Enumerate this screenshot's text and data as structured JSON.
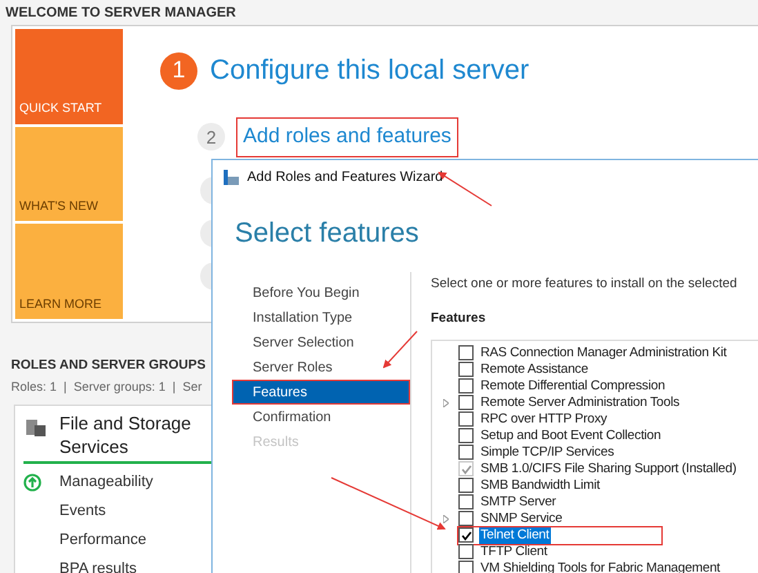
{
  "header": {
    "title": "WELCOME TO SERVER MANAGER"
  },
  "tiles": [
    {
      "label": "QUICK START",
      "color": "#f26522",
      "selected": true
    },
    {
      "label": "WHAT'S NEW",
      "color": "#fbb040",
      "selected": false
    },
    {
      "label": "LEARN MORE",
      "color": "#fbb040",
      "selected": false
    }
  ],
  "steps": [
    {
      "number": "1",
      "label": "Configure this local server",
      "kind": "primary",
      "annotated": false
    },
    {
      "number": "2",
      "label": "Add roles and features",
      "kind": "secondary",
      "annotated": true
    }
  ],
  "roles": {
    "title": "ROLES AND SERVER GROUPS",
    "summary": "Roles: 1  |  Server groups: 1  |  Ser",
    "card": {
      "title": "File and Storage Services",
      "rows": [
        {
          "label": "Manageability",
          "kind": "status"
        },
        {
          "label": "Events",
          "kind": "plain"
        },
        {
          "label": "Performance",
          "kind": "plain"
        },
        {
          "label": "BPA results",
          "kind": "plain"
        }
      ]
    }
  },
  "wizard": {
    "title": "Add Roles and Features Wizard",
    "heading": "Select features",
    "nav": [
      {
        "label": "Before You Begin",
        "selected": false,
        "disabled": false,
        "annotated": false
      },
      {
        "label": "Installation Type",
        "selected": false,
        "disabled": false,
        "annotated": false
      },
      {
        "label": "Server Selection",
        "selected": false,
        "disabled": false,
        "annotated": false
      },
      {
        "label": "Server Roles",
        "selected": false,
        "disabled": false,
        "annotated": false
      },
      {
        "label": "Features",
        "selected": true,
        "disabled": false,
        "annotated": true
      },
      {
        "label": "Confirmation",
        "selected": false,
        "disabled": false,
        "annotated": false
      },
      {
        "label": "Results",
        "selected": false,
        "disabled": true,
        "annotated": false
      }
    ],
    "description": "Select one or more features to install on the selected",
    "features_label": "Features",
    "features": [
      {
        "label": "RAS Connection Manager Administration Kit",
        "checked": false,
        "disabled": false,
        "expandable": false,
        "selected": false,
        "annotated": false
      },
      {
        "label": "Remote Assistance",
        "checked": false,
        "disabled": false,
        "expandable": false,
        "selected": false,
        "annotated": false
      },
      {
        "label": "Remote Differential Compression",
        "checked": false,
        "disabled": false,
        "expandable": false,
        "selected": false,
        "annotated": false
      },
      {
        "label": "Remote Server Administration Tools",
        "checked": false,
        "disabled": false,
        "expandable": true,
        "selected": false,
        "annotated": false
      },
      {
        "label": "RPC over HTTP Proxy",
        "checked": false,
        "disabled": false,
        "expandable": false,
        "selected": false,
        "annotated": false
      },
      {
        "label": "Setup and Boot Event Collection",
        "checked": false,
        "disabled": false,
        "expandable": false,
        "selected": false,
        "annotated": false
      },
      {
        "label": "Simple TCP/IP Services",
        "checked": false,
        "disabled": false,
        "expandable": false,
        "selected": false,
        "annotated": false
      },
      {
        "label": "SMB 1.0/CIFS File Sharing Support (Installed)",
        "checked": true,
        "disabled": true,
        "expandable": false,
        "selected": false,
        "annotated": false
      },
      {
        "label": "SMB Bandwidth Limit",
        "checked": false,
        "disabled": false,
        "expandable": false,
        "selected": false,
        "annotated": false
      },
      {
        "label": "SMTP Server",
        "checked": false,
        "disabled": false,
        "expandable": false,
        "selected": false,
        "annotated": false
      },
      {
        "label": "SNMP Service",
        "checked": false,
        "disabled": false,
        "expandable": true,
        "selected": false,
        "annotated": false
      },
      {
        "label": "Telnet Client",
        "checked": true,
        "disabled": false,
        "expandable": false,
        "selected": true,
        "annotated": true
      },
      {
        "label": "TFTP Client",
        "checked": false,
        "disabled": false,
        "expandable": false,
        "selected": false,
        "annotated": false
      },
      {
        "label": "VM Shielding Tools for Fabric Management",
        "checked": false,
        "disabled": false,
        "expandable": false,
        "selected": false,
        "annotated": false
      }
    ]
  }
}
